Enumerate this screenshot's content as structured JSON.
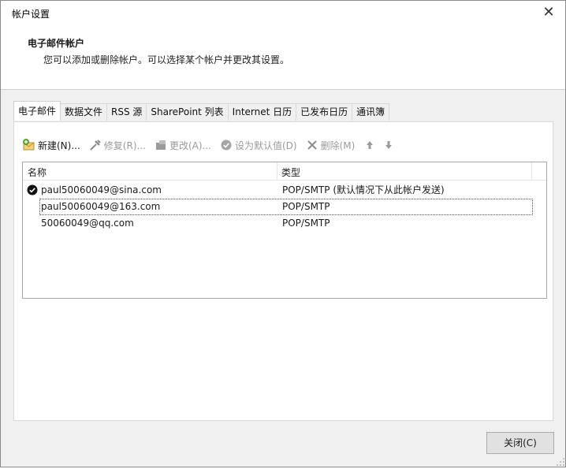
{
  "window": {
    "title": "帐户设置",
    "close_glyph": "✕"
  },
  "header": {
    "title": "电子邮件帐户",
    "description": "您可以添加或删除帐户。可以选择某个帐户并更改其设置。"
  },
  "tabs": [
    {
      "label": "电子邮件",
      "active": true
    },
    {
      "label": "数据文件",
      "active": false
    },
    {
      "label": "RSS 源",
      "active": false
    },
    {
      "label": "SharePoint 列表",
      "active": false
    },
    {
      "label": "Internet 日历",
      "active": false
    },
    {
      "label": "已发布日历",
      "active": false
    },
    {
      "label": "通讯簿",
      "active": false
    }
  ],
  "toolbar": {
    "new_label": "新建(N)...",
    "repair_label": "修复(R)...",
    "change_label": "更改(A)...",
    "set_default_label": "设为默认值(D)",
    "delete_label": "删除(M)",
    "move_up_icon": "arrow-up-icon",
    "move_down_icon": "arrow-down-icon"
  },
  "list": {
    "columns": [
      "名称",
      "类型"
    ],
    "rows": [
      {
        "name": "paul50060049@sina.com",
        "type": "POP/SMTP (默认情况下从此帐户发送)",
        "is_default": true,
        "focused": false
      },
      {
        "name": "paul50060049@163.com",
        "type": "POP/SMTP",
        "is_default": false,
        "focused": true
      },
      {
        "name": "50060049@qq.com",
        "type": "POP/SMTP",
        "is_default": false,
        "focused": false
      }
    ]
  },
  "footer": {
    "close_label": "关闭(C)"
  },
  "colors": {
    "panel_bg": "#f0f0f0",
    "content_bg": "#ffffff",
    "disabled_text": "#9b9b9b",
    "button_bg": "#e1e1e1"
  }
}
